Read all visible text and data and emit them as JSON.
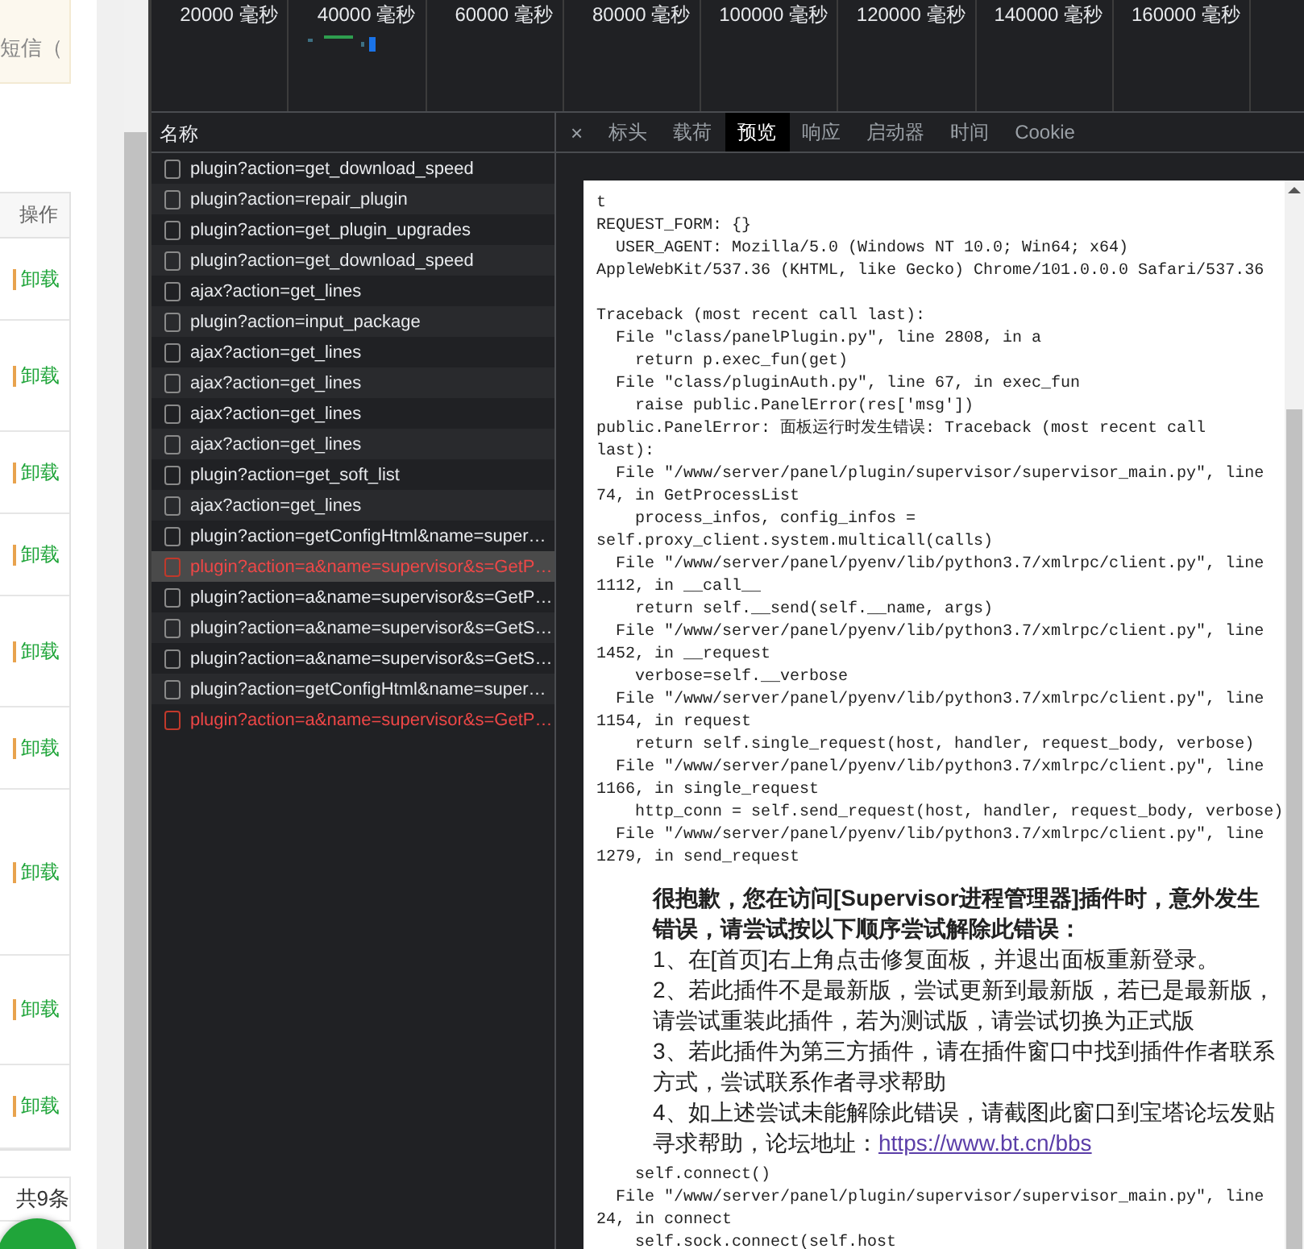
{
  "page": {
    "notice": "短信（",
    "table": {
      "header": "操作",
      "rows": [
        {
          "action": "卸载"
        },
        {
          "action": "卸载"
        },
        {
          "action": "卸载"
        },
        {
          "action": "卸载"
        },
        {
          "action": "卸载"
        },
        {
          "action": "卸载"
        },
        {
          "action": "卸载"
        },
        {
          "action": "卸载"
        },
        {
          "action": "卸载"
        }
      ]
    },
    "footer": "共9条"
  },
  "devtools": {
    "timeline": {
      "ticks": [
        "20000 毫秒",
        "40000 毫秒",
        "60000 毫秒",
        "80000 毫秒",
        "100000 毫秒",
        "120000 毫秒",
        "140000 毫秒",
        "160000 毫秒"
      ]
    },
    "network": {
      "header": "名称",
      "requests": [
        {
          "name": "plugin?action=get_download_speed",
          "failed": false,
          "selected": false
        },
        {
          "name": "plugin?action=repair_plugin",
          "failed": false,
          "selected": false
        },
        {
          "name": "plugin?action=get_plugin_upgrades",
          "failed": false,
          "selected": false
        },
        {
          "name": "plugin?action=get_download_speed",
          "failed": false,
          "selected": false
        },
        {
          "name": "ajax?action=get_lines",
          "failed": false,
          "selected": false
        },
        {
          "name": "plugin?action=input_package",
          "failed": false,
          "selected": false
        },
        {
          "name": "ajax?action=get_lines",
          "failed": false,
          "selected": false
        },
        {
          "name": "ajax?action=get_lines",
          "failed": false,
          "selected": false
        },
        {
          "name": "ajax?action=get_lines",
          "failed": false,
          "selected": false
        },
        {
          "name": "ajax?action=get_lines",
          "failed": false,
          "selected": false
        },
        {
          "name": "plugin?action=get_soft_list",
          "failed": false,
          "selected": false
        },
        {
          "name": "ajax?action=get_lines",
          "failed": false,
          "selected": false
        },
        {
          "name": "plugin?action=getConfigHtml&name=super…",
          "failed": false,
          "selected": false
        },
        {
          "name": "plugin?action=a&name=supervisor&s=GetP…",
          "failed": true,
          "selected": true
        },
        {
          "name": "plugin?action=a&name=supervisor&s=GetP…",
          "failed": false,
          "selected": false
        },
        {
          "name": "plugin?action=a&name=supervisor&s=GetS…",
          "failed": false,
          "selected": false
        },
        {
          "name": "plugin?action=a&name=supervisor&s=GetS…",
          "failed": false,
          "selected": false
        },
        {
          "name": "plugin?action=getConfigHtml&name=super…",
          "failed": false,
          "selected": false
        },
        {
          "name": "plugin?action=a&name=supervisor&s=GetP…",
          "failed": true,
          "selected": false
        }
      ]
    },
    "close": "×",
    "tabs": [
      {
        "label": "标头",
        "selected": false
      },
      {
        "label": "载荷",
        "selected": false
      },
      {
        "label": "预览",
        "selected": true
      },
      {
        "label": "响应",
        "selected": false
      },
      {
        "label": "启动器",
        "selected": false
      },
      {
        "label": "时间",
        "selected": false
      },
      {
        "label": "Cookie",
        "selected": false
      }
    ],
    "preview": {
      "request_lines": [
        "t",
        "REQUEST_FORM: {}",
        "  USER_AGENT: Mozilla/5.0 (Windows NT 10.0; Win64; x64)",
        "AppleWebKit/537.36 (KHTML, like Gecko) Chrome/101.0.0.0 Safari/537.36"
      ],
      "lines_before": [
        "Traceback (most recent call last):",
        "  File \"class/panelPlugin.py\", line 2808, in a",
        "    return p.exec_fun(get)",
        "  File \"class/pluginAuth.py\", line 67, in exec_fun",
        "    raise public.PanelError(res['msg'])",
        "public.PanelError: 面板运行时发生错误: Traceback (most recent call",
        "last):",
        "  File \"/www/server/panel/plugin/supervisor/supervisor_main.py\", line",
        "74, in GetProcessList",
        "    process_infos, config_infos =",
        "self.proxy_client.system.multicall(calls)",
        "  File \"/www/server/panel/pyenv/lib/python3.7/xmlrpc/client.py\", line",
        "1112, in __call__",
        "    return self.__send(self.__name, args)",
        "  File \"/www/server/panel/pyenv/lib/python3.7/xmlrpc/client.py\", line",
        "1452, in __request",
        "    verbose=self.__verbose",
        "  File \"/www/server/panel/pyenv/lib/python3.7/xmlrpc/client.py\", line",
        "1154, in request",
        "    return self.single_request(host, handler, request_body, verbose)",
        "  File \"/www/server/panel/pyenv/lib/python3.7/xmlrpc/client.py\", line",
        "1166, in single_request",
        "    http_conn = self.send_request(host, handler, request_body, verbose)",
        "  File \"/www/server/panel/pyenv/lib/python3.7/xmlrpc/client.py\", line",
        "1279, in send_request"
      ],
      "error_notice": {
        "title": "很抱歉，您在访问[Supervisor进程管理器]插件时，意外发生错误，请尝试按以下顺序尝试解除此错误：",
        "items": [
          "1、在[首页]右上角点击修复面板，并退出面板重新登录。",
          "2、若此插件不是最新版，尝试更新到最新版，若已是最新版，请尝试重装此插件，若为测试版，请尝试切换为正式版",
          "3、若此插件为第三方插件，请在插件窗口中找到插件作者联系方式，尝试联系作者寻求帮助",
          "4、如上述尝试未能解除此错误，请截图此窗口到宝塔论坛发贴寻求帮助，论坛地址："
        ],
        "link": "https://www.bt.cn/bbs"
      },
      "lines_after": [
        "    self.connect()",
        "  File \"/www/server/panel/plugin/supervisor/supervisor_main.py\", line",
        "24, in connect",
        "    self.sock.connect(self.host"
      ]
    }
  }
}
